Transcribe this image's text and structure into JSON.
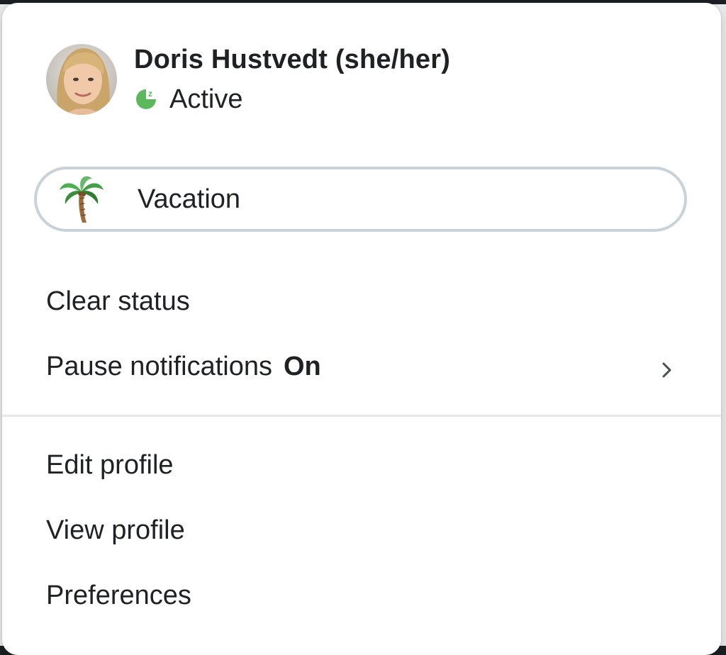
{
  "profile": {
    "name": "Doris Hustvedt (she/her)",
    "presence": "Active",
    "avatar_icon": "user-avatar-photo"
  },
  "status": {
    "emoji_icon": "palm-tree-icon",
    "text": "Vacation"
  },
  "menu": {
    "clear_status": "Clear status",
    "pause_notifications_label": "Pause notifications",
    "pause_notifications_value": "On",
    "edit_profile": "Edit profile",
    "view_profile": "View profile",
    "preferences": "Preferences"
  },
  "colors": {
    "presence_active": "#5cb85c",
    "pill_border": "#c9d1d9",
    "text": "#1f2124"
  }
}
